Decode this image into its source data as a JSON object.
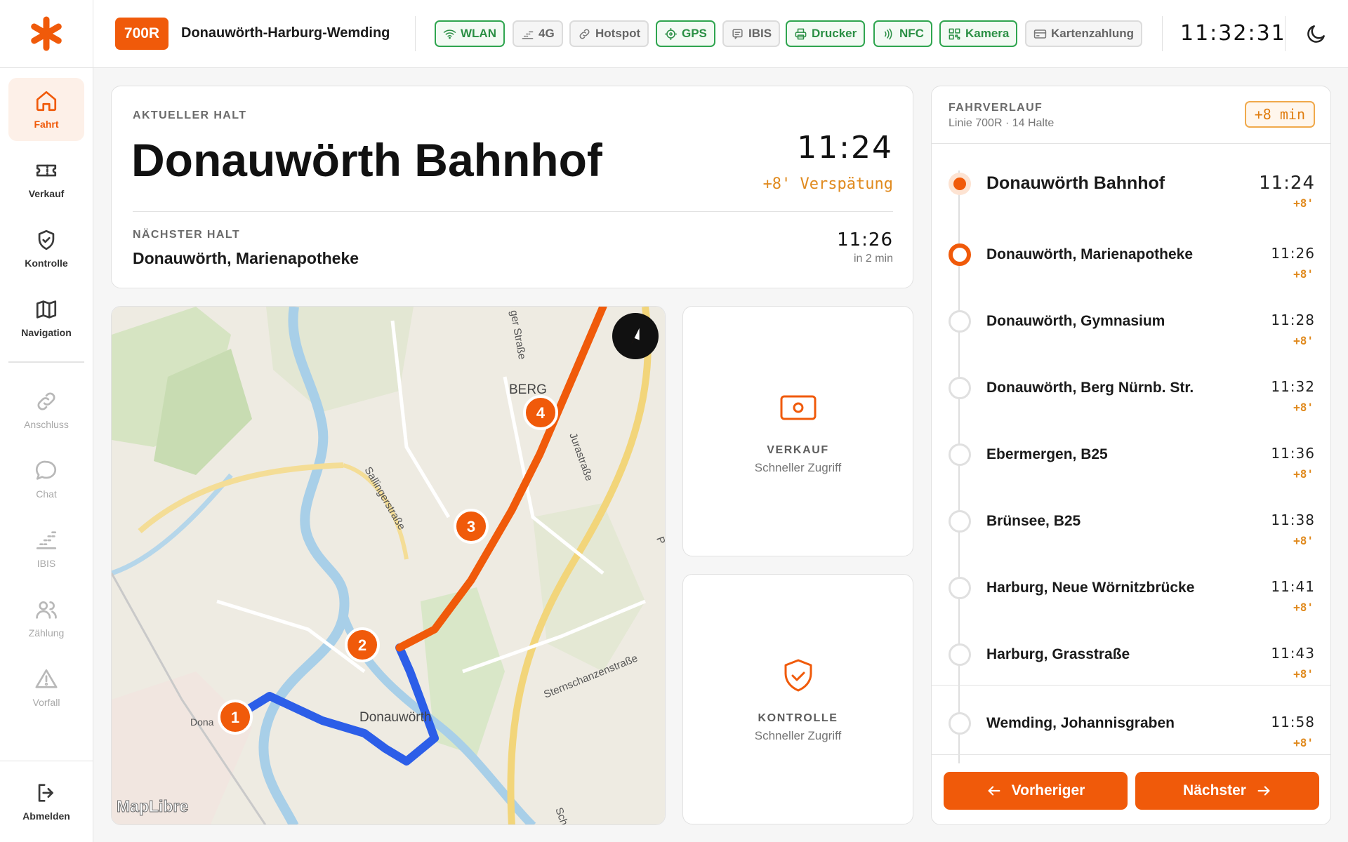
{
  "sidebar": {
    "items": [
      {
        "label": "Fahrt",
        "icon": "home-icon"
      },
      {
        "label": "Verkauf",
        "icon": "ticket-icon"
      },
      {
        "label": "Kontrolle",
        "icon": "shield-check-icon"
      },
      {
        "label": "Navigation",
        "icon": "map-icon"
      },
      {
        "label": "Anschluss",
        "icon": "link-icon"
      },
      {
        "label": "Chat",
        "icon": "chat-icon"
      },
      {
        "label": "IBIS",
        "icon": "signal-icon"
      },
      {
        "label": "Zählung",
        "icon": "users-icon"
      },
      {
        "label": "Vorfall",
        "icon": "alert-icon"
      }
    ],
    "logout_label": "Abmelden"
  },
  "header": {
    "line": "700R",
    "route": "Donauwörth-Harburg-Wemding",
    "status": [
      {
        "label": "WLAN",
        "on": true,
        "icon": "wifi-icon"
      },
      {
        "label": "4G",
        "on": false,
        "icon": "signal-icon"
      },
      {
        "label": "Hotspot",
        "on": false,
        "icon": "link-icon"
      },
      {
        "label": "GPS",
        "on": true,
        "icon": "crosshair-icon"
      },
      {
        "label": "IBIS",
        "on": false,
        "icon": "message-icon"
      },
      {
        "label": "Drucker",
        "on": true,
        "icon": "printer-icon"
      },
      {
        "label": "NFC",
        "on": true,
        "icon": "nfc-icon"
      },
      {
        "label": "Kamera",
        "on": true,
        "icon": "qr-icon"
      },
      {
        "label": "Kartenzahlung",
        "on": false,
        "icon": "card-icon"
      }
    ],
    "clock": "11:32:31"
  },
  "current": {
    "label": "AKTUELLER HALT",
    "name": "Donauwörth Bahnhof",
    "time": "11:24",
    "delay": "+8' Verspätung",
    "next_label": "NÄCHSTER HALT",
    "next_name": "Donauwörth, Marienapotheke",
    "next_time": "11:26",
    "next_eta": "in 2 min"
  },
  "map": {
    "labels": {
      "berg": "BERG",
      "donauwoerth": "Donauwörth",
      "donau": "Dona",
      "sallinger": "Sallingerstraße",
      "jura": "Jurastraße",
      "sternschanzen": "Sternschanzenstraße",
      "nuernberger": "ger Straße",
      "partial_p": "P",
      "partial_sch": "Sch"
    },
    "markers": [
      "1",
      "2",
      "3",
      "4"
    ],
    "attribution": "MapLibre"
  },
  "quick": {
    "verkauf_title": "VERKAUF",
    "verkauf_sub": "Schneller Zugriff",
    "kontrolle_title": "KONTROLLE",
    "kontrolle_sub": "Schneller Zugriff"
  },
  "route": {
    "title": "FAHRVERLAUF",
    "subtitle": "Linie 700R · 14 Halte",
    "delay": "+8 min",
    "stops": [
      {
        "name": "Donauwörth Bahnhof",
        "time": "11:24",
        "delay": "+8'",
        "state": "current"
      },
      {
        "name": "Donauwörth, Marienapotheke",
        "time": "11:26",
        "delay": "+8'",
        "state": "next"
      },
      {
        "name": "Donauwörth, Gymnasium",
        "time": "11:28",
        "delay": "+8'",
        "state": "upcoming"
      },
      {
        "name": "Donauwörth, Berg Nürnb. Str.",
        "time": "11:32",
        "delay": "+8'",
        "state": "upcoming"
      },
      {
        "name": "Ebermergen, B25",
        "time": "11:36",
        "delay": "+8'",
        "state": "upcoming"
      },
      {
        "name": "Brünsee, B25",
        "time": "11:38",
        "delay": "+8'",
        "state": "upcoming"
      },
      {
        "name": "Harburg, Neue Wörnitzbrücke",
        "time": "11:41",
        "delay": "+8'",
        "state": "upcoming"
      },
      {
        "name": "Harburg, Grasstraße",
        "time": "11:43",
        "delay": "+8'",
        "state": "upcoming"
      },
      {
        "name": "Wemding, Johannisgraben",
        "time": "11:58",
        "delay": "+8'",
        "state": "upcoming"
      }
    ],
    "prev_label": "Vorheriger",
    "next_label": "Nächster"
  },
  "colors": {
    "accent": "#f05a0a",
    "ok": "#2a8f44",
    "delay": "#e08a1e",
    "route_past": "#2c5ee8"
  }
}
